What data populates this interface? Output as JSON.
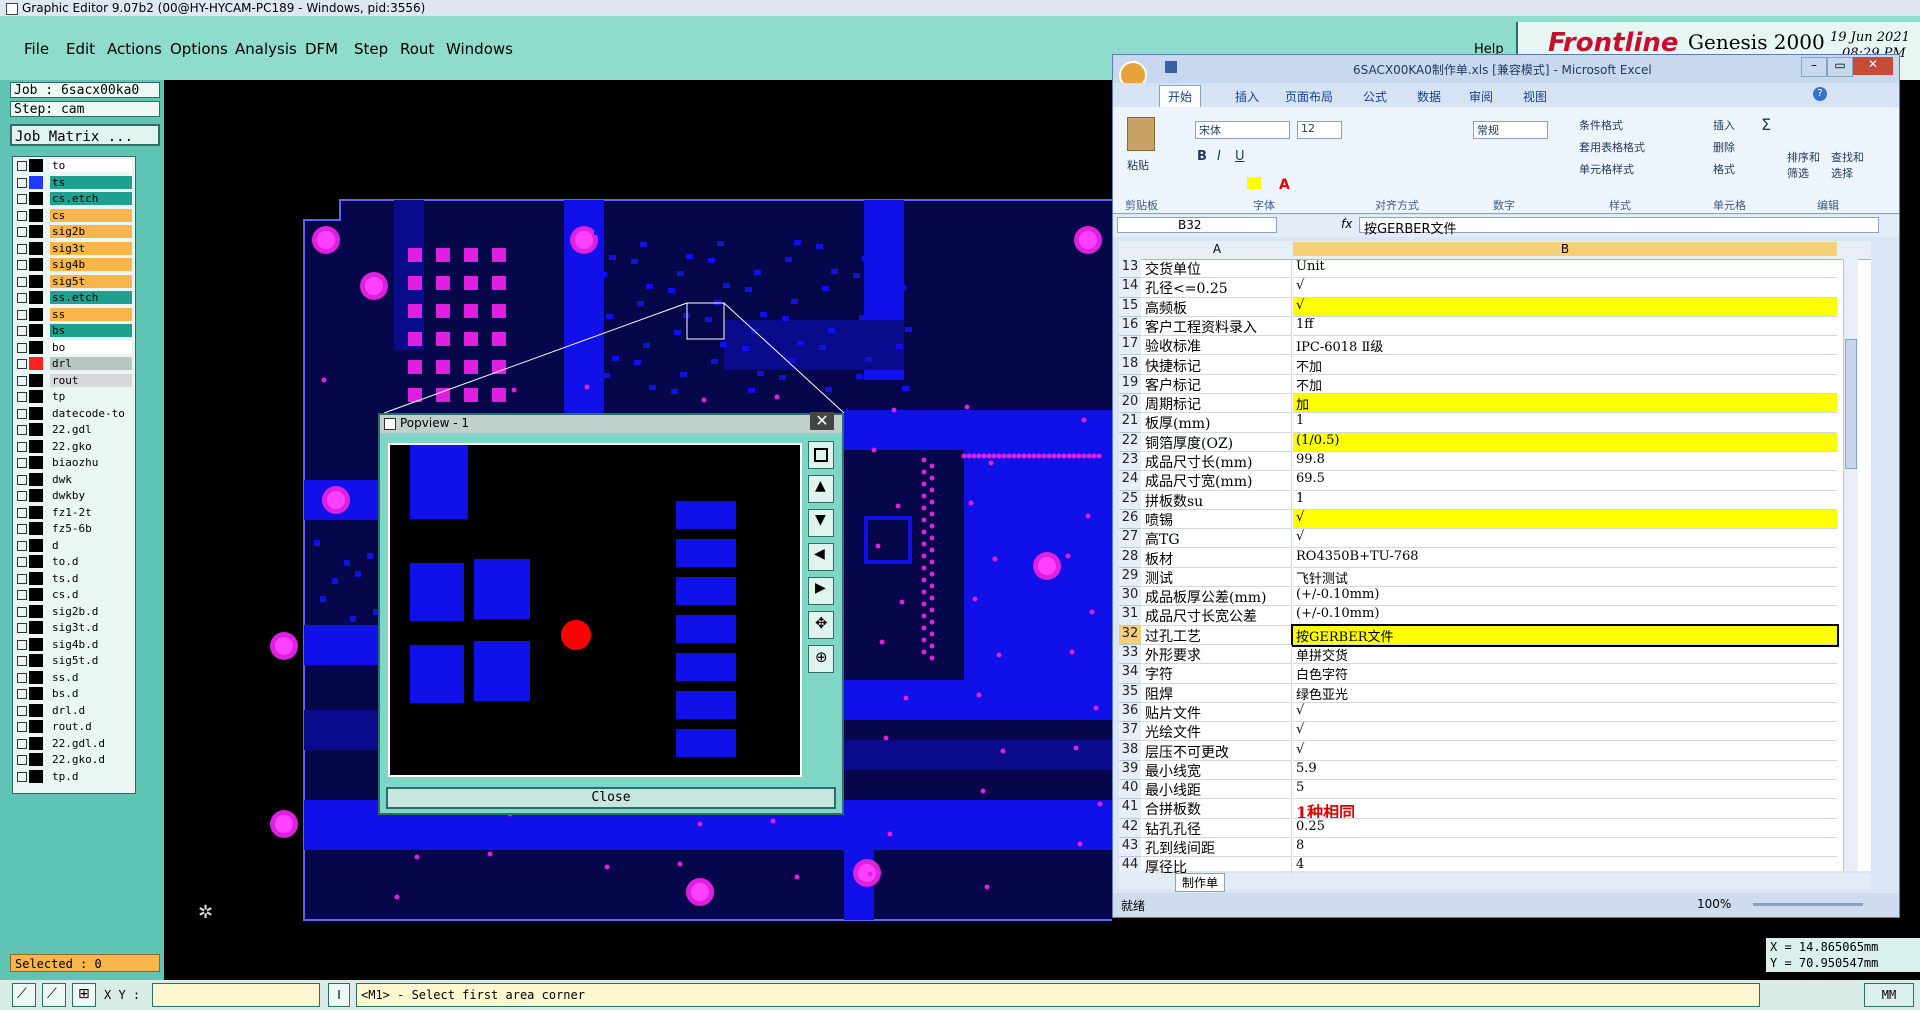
{
  "titlebar": {
    "title": "Graphic Editor 9.07b2 (00@HY-HYCAM-PC189 - Windows, pid:3556)"
  },
  "menu": [
    "File",
    "Edit",
    "Actions",
    "Options",
    "Analysis",
    "DFM",
    "Step",
    "Rout",
    "Windows"
  ],
  "help_label": "Help",
  "brand": {
    "logo": "Frontline",
    "product": "Genesis 2000",
    "date": "19 Jun 2021",
    "time": "08:29 PM"
  },
  "job": {
    "job_label": "Job : 6sacx00ka0",
    "step_label": "Step: cam",
    "matrix_button": "Job Matrix ..."
  },
  "layers": [
    {
      "name": "to",
      "color": "#ffffff",
      "swatch": "#000000"
    },
    {
      "name": "ts",
      "color": "#20a090",
      "swatch": "#1e3cff"
    },
    {
      "name": "cs.etch",
      "color": "#20a090",
      "swatch": "#000000"
    },
    {
      "name": "cs",
      "color": "#f7b54a",
      "swatch": "#000000"
    },
    {
      "name": "sig2b",
      "color": "#f7b54a",
      "swatch": "#000000"
    },
    {
      "name": "sig3t",
      "color": "#f7b54a",
      "swatch": "#000000"
    },
    {
      "name": "sig4b",
      "color": "#f7b54a",
      "swatch": "#000000"
    },
    {
      "name": "sig5t",
      "color": "#f7b54a",
      "swatch": "#000000"
    },
    {
      "name": "ss.etch",
      "color": "#20a090",
      "swatch": "#000000"
    },
    {
      "name": "ss",
      "color": "#f7b54a",
      "swatch": "#000000"
    },
    {
      "name": "bs",
      "color": "#20a090",
      "swatch": "#000000"
    },
    {
      "name": "bo",
      "color": "#ffffff",
      "swatch": "#000000"
    },
    {
      "name": "drl",
      "color": "#b8c6c4",
      "swatch": "#ff2020"
    },
    {
      "name": "rout",
      "color": "#d8d8d8",
      "swatch": "#000000"
    },
    {
      "name": "tp",
      "color": "#eaf6f3",
      "swatch": "#000000"
    },
    {
      "name": "datecode-to",
      "color": "#eaf6f3",
      "swatch": "#000000"
    },
    {
      "name": "22.gdl",
      "color": "#eaf6f3",
      "swatch": "#000000"
    },
    {
      "name": "22.gko",
      "color": "#eaf6f3",
      "swatch": "#000000"
    },
    {
      "name": "biaozhu",
      "color": "#eaf6f3",
      "swatch": "#000000"
    },
    {
      "name": "dwk",
      "color": "#eaf6f3",
      "swatch": "#000000"
    },
    {
      "name": "dwkby",
      "color": "#eaf6f3",
      "swatch": "#000000"
    },
    {
      "name": "fz1-2t",
      "color": "#eaf6f3",
      "swatch": "#000000"
    },
    {
      "name": "fz5-6b",
      "color": "#eaf6f3",
      "swatch": "#000000"
    },
    {
      "name": "d",
      "color": "#eaf6f3",
      "swatch": "#000000"
    },
    {
      "name": "to.d",
      "color": "#eaf6f3",
      "swatch": "#000000"
    },
    {
      "name": "ts.d",
      "color": "#eaf6f3",
      "swatch": "#000000"
    },
    {
      "name": "cs.d",
      "color": "#eaf6f3",
      "swatch": "#000000"
    },
    {
      "name": "sig2b.d",
      "color": "#eaf6f3",
      "swatch": "#000000"
    },
    {
      "name": "sig3t.d",
      "color": "#eaf6f3",
      "swatch": "#000000"
    },
    {
      "name": "sig4b.d",
      "color": "#eaf6f3",
      "swatch": "#000000"
    },
    {
      "name": "sig5t.d",
      "color": "#eaf6f3",
      "swatch": "#000000"
    },
    {
      "name": "ss.d",
      "color": "#eaf6f3",
      "swatch": "#000000"
    },
    {
      "name": "bs.d",
      "color": "#eaf6f3",
      "swatch": "#000000"
    },
    {
      "name": "drl.d",
      "color": "#eaf6f3",
      "swatch": "#000000"
    },
    {
      "name": "rout.d",
      "color": "#eaf6f3",
      "swatch": "#000000"
    },
    {
      "name": "22.gdl.d",
      "color": "#eaf6f3",
      "swatch": "#000000"
    },
    {
      "name": "22.gko.d",
      "color": "#eaf6f3",
      "swatch": "#000000"
    },
    {
      "name": "tp.d",
      "color": "#eaf6f3",
      "swatch": "#000000"
    }
  ],
  "selected_label": "Selected : 0",
  "popview": {
    "title": "Popview - 1",
    "close": "Close"
  },
  "coords": {
    "x": "X = 14.865065mm",
    "y": "Y = 70.950547mm",
    "units": "MM"
  },
  "status": {
    "xy_label": "X Y :",
    "prompt": "<M1> - Select first area corner"
  },
  "excel": {
    "title": "6SACX00KA0制作单.xls  [兼容模式] - Microsoft Excel",
    "tabs": [
      "开始",
      "插入",
      "页面布局",
      "公式",
      "数据",
      "审阅",
      "视图"
    ],
    "font_name": "宋体",
    "font_size": "12",
    "number_format": "常规",
    "ribbon": {
      "paste": "粘贴",
      "cond_format": "条件格式",
      "table_format": "套用表格格式",
      "cell_style": "单元格样式",
      "insert": "插入",
      "delete": "删除",
      "format": "格式",
      "sort_filter": "排序和\n筛选",
      "find_select": "查找和\n选择"
    },
    "groups": [
      "剪贴板",
      "字体",
      "对齐方式",
      "数字",
      "样式",
      "单元格",
      "编辑"
    ],
    "name_box": "B32",
    "formula": "按GERBER文件",
    "col_a": "A",
    "col_b": "B",
    "rows": [
      {
        "n": "13",
        "a": "交货单位",
        "b": "Unit",
        "hl": false
      },
      {
        "n": "14",
        "a": "孔径<=0.25",
        "b": "√",
        "hl": false
      },
      {
        "n": "15",
        "a": "高频板",
        "b": "√",
        "hl": true
      },
      {
        "n": "16",
        "a": "客户工程资料录入",
        "b": "1ff",
        "hl": false
      },
      {
        "n": "17",
        "a": "验收标准",
        "b": "IPC-6018 Ⅱ级",
        "hl": false
      },
      {
        "n": "18",
        "a": "快捷标记",
        "b": "不加",
        "hl": false
      },
      {
        "n": "19",
        "a": "客户标记",
        "b": "不加",
        "hl": false
      },
      {
        "n": "20",
        "a": "周期标记",
        "b": "加",
        "hl": true
      },
      {
        "n": "21",
        "a": "板厚(mm)",
        "b": "1",
        "hl": false
      },
      {
        "n": "22",
        "a": "铜箔厚度(OZ)",
        "b": "(1/0.5)",
        "hl": true
      },
      {
        "n": "23",
        "a": "成品尺寸长(mm)",
        "b": "99.8",
        "hl": false
      },
      {
        "n": "24",
        "a": "成品尺寸宽(mm)",
        "b": "69.5",
        "hl": false
      },
      {
        "n": "25",
        "a": "拼板数su",
        "b": "1",
        "hl": false
      },
      {
        "n": "26",
        "a": "喷锡",
        "b": "√",
        "hl": true
      },
      {
        "n": "27",
        "a": "高TG",
        "b": "√",
        "hl": false
      },
      {
        "n": "28",
        "a": "板材",
        "b": "RO4350B+TU-768",
        "hl": false
      },
      {
        "n": "29",
        "a": "测试",
        "b": "飞针测试",
        "hl": false
      },
      {
        "n": "30",
        "a": "成品板厚公差(mm)",
        "b": "(+/-0.10mm)",
        "hl": false
      },
      {
        "n": "31",
        "a": "成品尺寸长宽公差",
        "b": "(+/-0.10mm)",
        "hl": false
      },
      {
        "n": "32",
        "a": "过孔工艺",
        "b": "按GERBER文件",
        "hl": true
      },
      {
        "n": "33",
        "a": "外形要求",
        "b": "单拼交货",
        "hl": false
      },
      {
        "n": "34",
        "a": "字符",
        "b": "白色字符",
        "hl": false
      },
      {
        "n": "35",
        "a": "阻焊",
        "b": "绿色亚光",
        "hl": false
      },
      {
        "n": "36",
        "a": "贴片文件",
        "b": "√",
        "hl": false
      },
      {
        "n": "37",
        "a": "光绘文件",
        "b": "√",
        "hl": false
      },
      {
        "n": "38",
        "a": "层压不可更改",
        "b": "√",
        "hl": false
      },
      {
        "n": "39",
        "a": "最小线宽",
        "b": "5.9",
        "hl": false
      },
      {
        "n": "40",
        "a": "最小线距",
        "b": "5",
        "hl": false
      },
      {
        "n": "41",
        "a": "合拼板数",
        "b": "1种相同",
        "hl": false,
        "red": true
      },
      {
        "n": "42",
        "a": "钻孔孔径",
        "b": "0.25",
        "hl": false
      },
      {
        "n": "43",
        "a": "孔到线间距",
        "b": "8",
        "hl": false
      },
      {
        "n": "44",
        "a": "厚径比",
        "b": "4",
        "hl": false
      }
    ],
    "sheet_tab": "制作单",
    "status_ready": "就绪",
    "zoom": "100%"
  }
}
